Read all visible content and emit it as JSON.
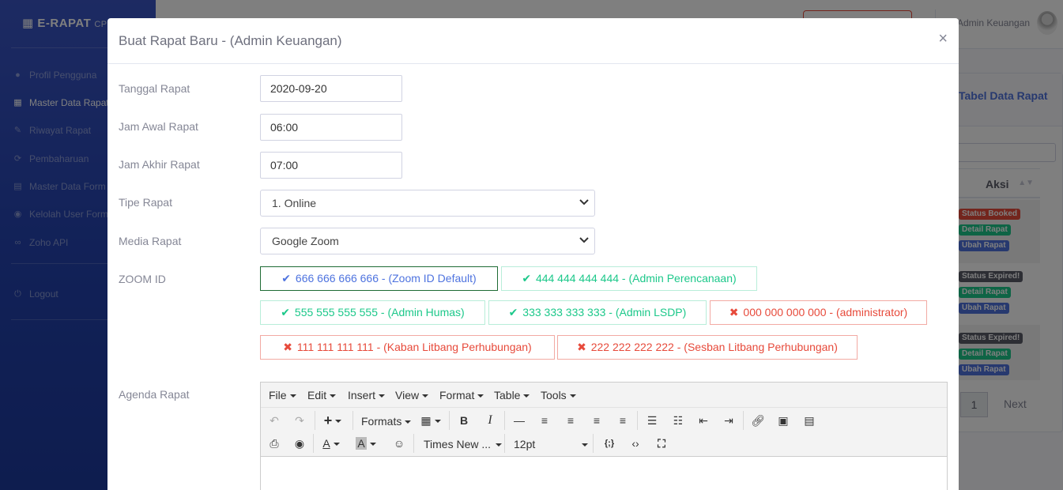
{
  "app": {
    "brand": "E-RAPAT",
    "brand_sub": "CP",
    "sidebar_items": [
      {
        "label": "Profil Pengguna",
        "icon": "user-icon"
      },
      {
        "label": "Master Data Rapat",
        "icon": "calendar-icon"
      },
      {
        "label": "Riwayat Rapat",
        "icon": "edit-icon"
      },
      {
        "label": "Pembaharuan",
        "icon": "sync-icon"
      },
      {
        "label": "Master Data Form",
        "icon": "file-icon"
      },
      {
        "label": "Kelolah User Form",
        "icon": "user-circle-icon"
      },
      {
        "label": "Zoho API",
        "icon": "link-icon"
      }
    ],
    "logout": "Logout",
    "topbar_user": "Admin Keuangan",
    "card_title": "Tabel Data Rapat",
    "table_header": "Aksi",
    "rows": [
      [
        "Status Booked",
        "Detail Rapat",
        "Ubah Rapat"
      ],
      [
        "Status Expired!",
        "Detail Rapat",
        "Ubah Rapat"
      ],
      [
        "Status Expired!",
        "Detail Rapat",
        "Ubah Rapat"
      ]
    ],
    "pagination": {
      "current": "1",
      "next": "Next"
    }
  },
  "modal": {
    "title": "Buat Rapat Baru - (Admin Keuangan)",
    "close": "×",
    "fields": {
      "tanggal": {
        "label": "Tanggal Rapat",
        "value": "2020-09-20"
      },
      "jam_awal": {
        "label": "Jam Awal Rapat",
        "value": "06:00"
      },
      "jam_akhir": {
        "label": "Jam Akhir Rapat",
        "value": "07:00"
      },
      "tipe": {
        "label": "Tipe Rapat",
        "value": "1. Online"
      },
      "media": {
        "label": "Media Rapat",
        "value": "Google Zoom"
      },
      "zoom_label": "ZOOM ID",
      "agenda_label": "Agenda Rapat"
    },
    "zoom_ids": [
      {
        "mark": "✔",
        "text": "666 666 666 666 - (Zoom ID Default)",
        "state": "default"
      },
      {
        "mark": "✔",
        "text": "444 444 444 444 - (Admin Perencanaan)",
        "state": "available"
      },
      {
        "mark": "✔",
        "text": "555 555 555 555 - (Admin Humas)",
        "state": "available"
      },
      {
        "mark": "✔",
        "text": "333 333 333 333 - (Admin LSDP)",
        "state": "available"
      },
      {
        "mark": "✖",
        "text": "000 000 000 000 - (administrator)",
        "state": "unavailable"
      },
      {
        "mark": "✖",
        "text": "111 111 111 111 - (Kaban Litbang Perhubungan)",
        "state": "unavailable"
      },
      {
        "mark": "✖",
        "text": "222 222 222 222 - (Sesban Litbang Perhubungan)",
        "state": "unavailable"
      }
    ],
    "editor": {
      "menus": [
        "File",
        "Edit",
        "Insert",
        "View",
        "Format",
        "Table",
        "Tools"
      ],
      "formats_label": "Formats",
      "font_family": "Times New ...",
      "font_size": "12pt"
    }
  },
  "colors": {
    "primary": "#4e73df",
    "success": "#1cc88a",
    "danger": "#e74a3b",
    "default_border": "#1e6b34"
  }
}
